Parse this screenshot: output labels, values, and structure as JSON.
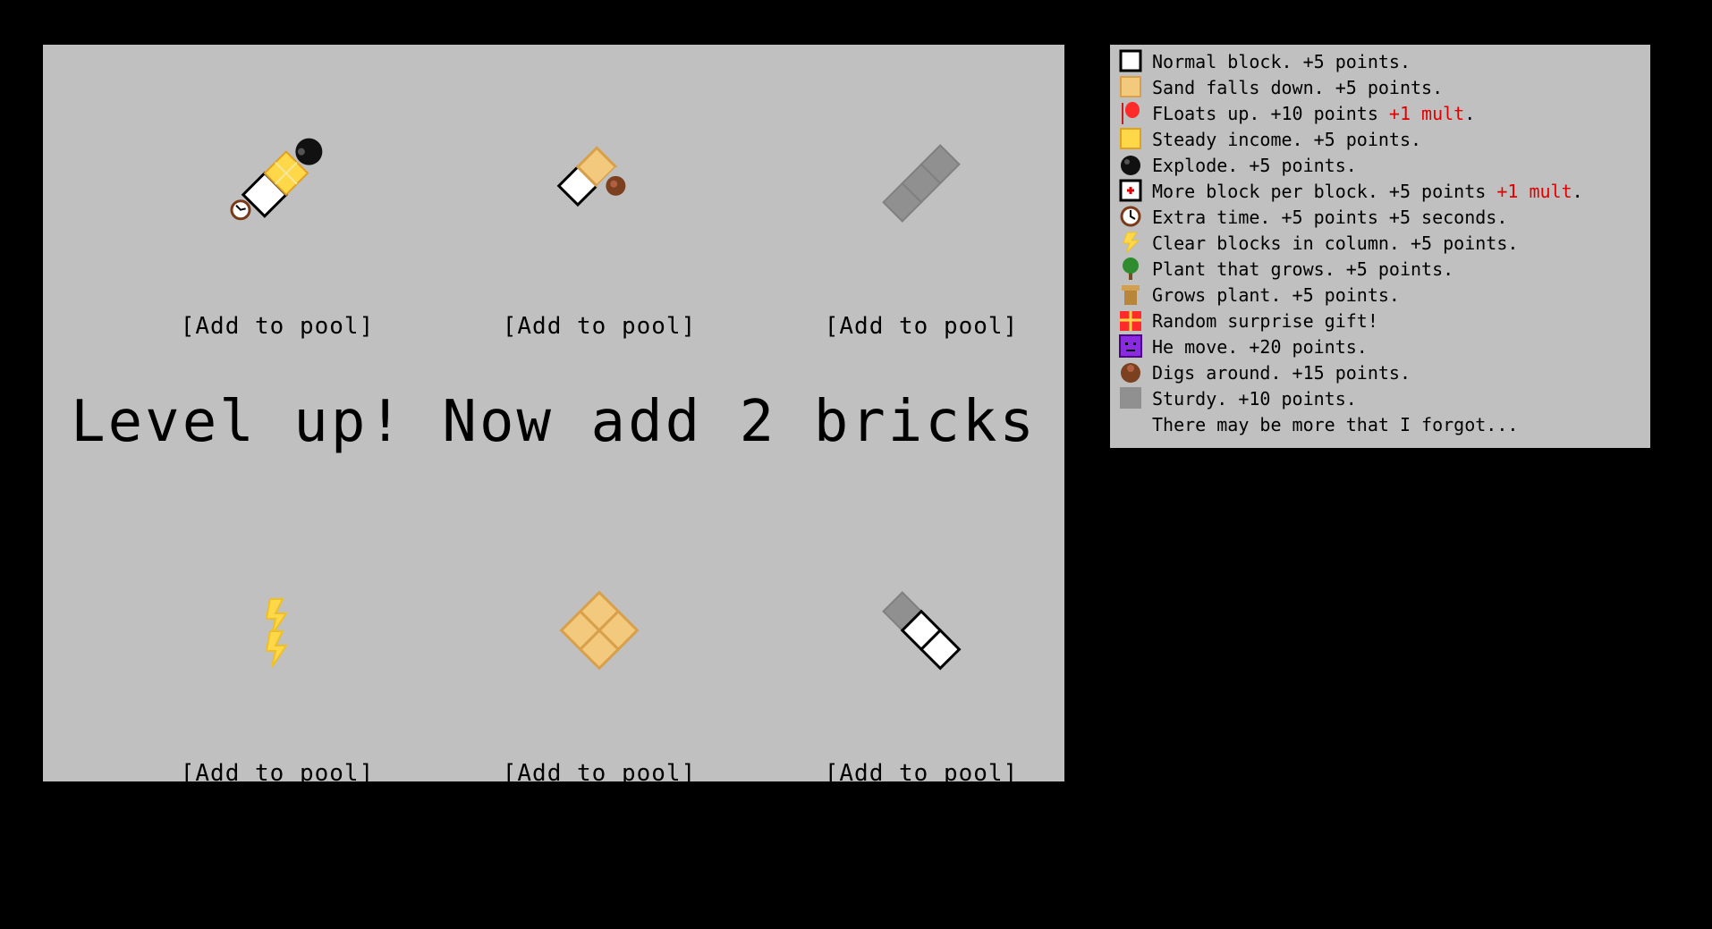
{
  "level_up_text": "Level up! Now add 2 bricks",
  "add_button_label": "[Add to pool]",
  "pieces": [
    {
      "name": "piece-1",
      "blocks": [
        "clock",
        "normal",
        "steady",
        "bomb"
      ]
    },
    {
      "name": "piece-2",
      "blocks": [
        "normal",
        "sand",
        "digger"
      ]
    },
    {
      "name": "piece-3",
      "blocks": [
        "sturdy",
        "sturdy",
        "sturdy"
      ]
    },
    {
      "name": "piece-4",
      "blocks": [
        "lightning",
        "lightning"
      ]
    },
    {
      "name": "piece-5",
      "blocks": [
        "sand",
        "sand",
        "sand",
        "sand"
      ]
    },
    {
      "name": "piece-6",
      "blocks": [
        "sturdy",
        "normal",
        "normal"
      ]
    }
  ],
  "legend": [
    {
      "icon": "normal-block-icon",
      "text": "Normal block. +5 points."
    },
    {
      "icon": "sand-block-icon",
      "text": "Sand falls down. +5 points."
    },
    {
      "icon": "balloon-block-icon",
      "text": "FLoats up. +10 points",
      "mult": "+1 mult",
      "tail": "."
    },
    {
      "icon": "steady-block-icon",
      "text": "Steady income. +5 points."
    },
    {
      "icon": "bomb-block-icon",
      "text": "Explode. +5 points."
    },
    {
      "icon": "plus-block-icon",
      "text": "More block per block. +5 points",
      "mult": "+1 mult",
      "tail": "."
    },
    {
      "icon": "clock-block-icon",
      "text": "Extra time. +5 points +5 seconds."
    },
    {
      "icon": "lightning-block-icon",
      "text": "Clear blocks in column. +5 points."
    },
    {
      "icon": "plant-block-icon",
      "text": "Plant that grows. +5 points."
    },
    {
      "icon": "pot-block-icon",
      "text": "Grows plant. +5 points."
    },
    {
      "icon": "gift-block-icon",
      "text": "Random surprise gift!"
    },
    {
      "icon": "monster-block-icon",
      "text": "He move. +20 points."
    },
    {
      "icon": "digger-block-icon",
      "text": "Digs around. +15 points."
    },
    {
      "icon": "sturdy-block-icon",
      "text": "Sturdy. +10 points."
    },
    {
      "icon": "",
      "text": "There may be more that I forgot..."
    }
  ],
  "colors": {
    "background": "#000000",
    "panel": "#c0c0c0",
    "mult_red": "#e00000",
    "sand": "#f2c97d",
    "sturdy": "#909090",
    "steady": "#ffd84a"
  }
}
